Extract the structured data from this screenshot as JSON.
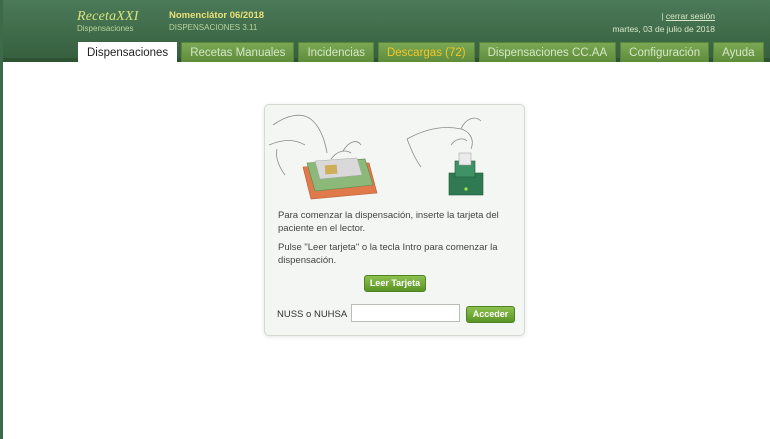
{
  "header": {
    "logo_text": "RecetaXXI",
    "logo_sub": "Dispensaciones",
    "app_title": "Nomenclátor 06/2018",
    "app_version": "DISPENSACIONES 3.11",
    "separator": "|",
    "logout_link": "cerrar sesión",
    "date": "martes, 03 de julio de 2018"
  },
  "tabs": [
    {
      "label": "Dispensaciones",
      "active": true
    },
    {
      "label": "Recetas Manuales",
      "active": false
    },
    {
      "label": "Incidencias",
      "active": false
    },
    {
      "label": "Descargas (72)",
      "active": false
    },
    {
      "label": "Dispensaciones CC.AA",
      "active": false
    },
    {
      "label": "Configuración",
      "active": false
    },
    {
      "label": "Ayuda",
      "active": false
    }
  ],
  "panel": {
    "message1": "Para comenzar la dispensación, inserte la tarjeta del paciente en el lector.",
    "message2": "Pulse \"Leer tarjeta\" o la tecla Intro para comenzar la dispensación.",
    "read_card_button": "Leer Tarjeta",
    "nuss_label": "NUSS o NUHSA",
    "nuss_value": "",
    "access_button": "Acceder"
  },
  "colors": {
    "header_green": "#3f6a4c",
    "tab_green": "#6f9d48",
    "highlight_yellow": "#f2c52a",
    "button_green": "#6ea636"
  }
}
